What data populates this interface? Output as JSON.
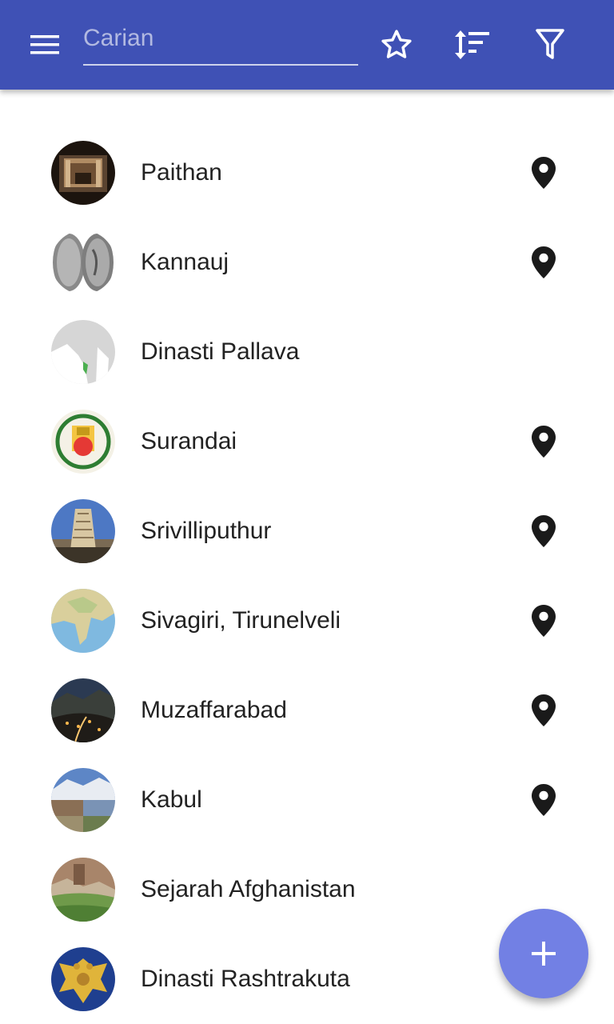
{
  "search": {
    "placeholder": "Carian"
  },
  "toolbar": {
    "menu_icon": "menu-icon",
    "favorite_icon": "star-outline-icon",
    "sort_icon": "sort-icon",
    "filter_icon": "filter-icon"
  },
  "list": {
    "items": [
      {
        "label": "Paithan",
        "has_location": true,
        "avatar": "temple-interior-thumbnail"
      },
      {
        "label": "Kannauj",
        "has_location": true,
        "avatar": "coin-thumbnail"
      },
      {
        "label": "Dinasti Pallava",
        "has_location": false,
        "avatar": "map-thumbnail"
      },
      {
        "label": "Surandai",
        "has_location": true,
        "avatar": "emblem-thumbnail"
      },
      {
        "label": "Srivilliputhur",
        "has_location": true,
        "avatar": "temple-tower-thumbnail"
      },
      {
        "label": "Sivagiri, Tirunelveli",
        "has_location": true,
        "avatar": "india-map-thumbnail"
      },
      {
        "label": "Muzaffarabad",
        "has_location": true,
        "avatar": "city-night-thumbnail"
      },
      {
        "label": "Kabul",
        "has_location": true,
        "avatar": "city-collage-thumbnail"
      },
      {
        "label": "Sejarah Afghanistan",
        "has_location": false,
        "avatar": "valley-thumbnail"
      },
      {
        "label": "Dinasti Rashtrakuta",
        "has_location": false,
        "avatar": "eagle-emblem-thumbnail"
      }
    ]
  },
  "fab": {
    "icon": "plus-icon"
  },
  "colors": {
    "appbar": "#3f51b5",
    "fab": "#7280e4",
    "text": "#222222",
    "pin": "#1a1a1a"
  }
}
